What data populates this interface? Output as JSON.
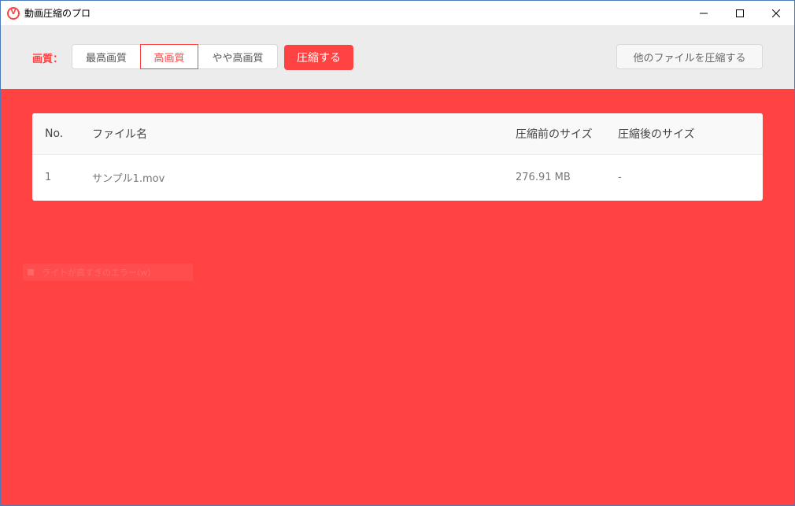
{
  "window": {
    "title": "動画圧縮のプロ",
    "icon": "app-logo-icon",
    "icon_letter": "V",
    "controls": [
      "minimize-icon",
      "maximize-icon",
      "close-icon"
    ]
  },
  "toolbar": {
    "quality_label": "画質：",
    "quality_options": [
      "最高画質",
      "高画質",
      "やや高画質"
    ],
    "selected_quality": "高画質",
    "compress_label": "圧縮する",
    "other_files_label": "他のファイルを圧縮する"
  },
  "table": {
    "headers": [
      "No.",
      "ファイル名",
      "圧縮前のサイズ",
      "圧縮後のサイズ"
    ],
    "rows": [
      [
        "1",
        "サンプル1.mov",
        "276.91 MB",
        "-"
      ]
    ]
  },
  "overlay": {
    "text": "ライトが高すぎのエラー(w)"
  },
  "colors": {
    "accent": "#ff4343",
    "toolbar_bg": "#ececec",
    "table_header_bg": "#f9f9f9"
  }
}
